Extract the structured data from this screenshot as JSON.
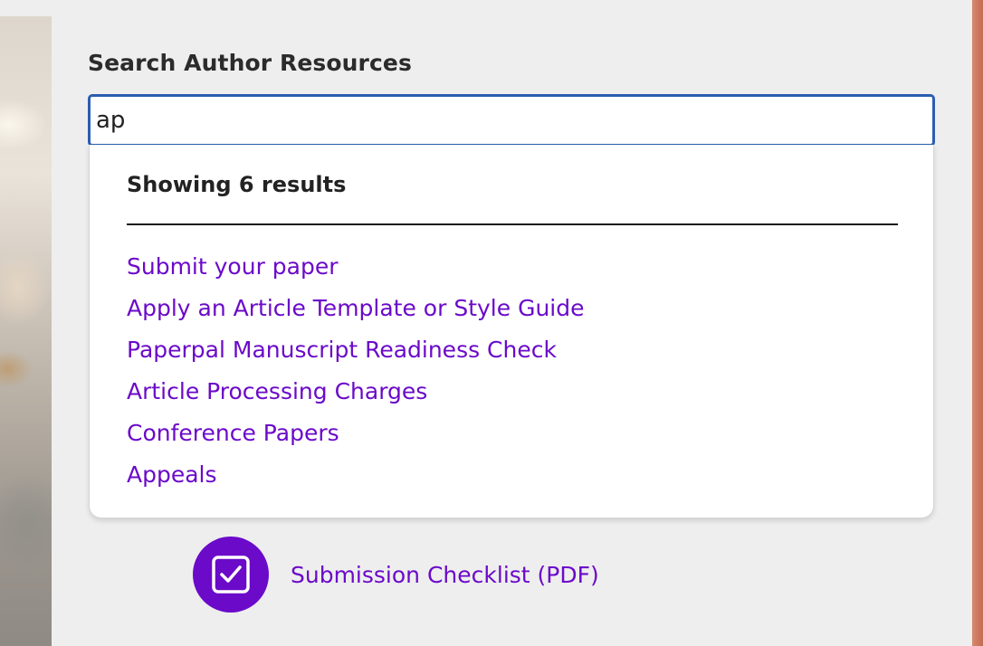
{
  "search": {
    "label": "Search Author Resources",
    "value": "ap"
  },
  "results": {
    "count_text": "Showing 6 results",
    "items": [
      {
        "label": "Submit your paper"
      },
      {
        "label": "Apply an Article Template or Style Guide"
      },
      {
        "label": "Paperpal Manuscript Readiness Check"
      },
      {
        "label": "Article Processing Charges"
      },
      {
        "label": "Conference Papers"
      },
      {
        "label": "Appeals"
      }
    ]
  },
  "checklist": {
    "label": "Submission Checklist (PDF)",
    "icon": "checkbox-checked-icon"
  },
  "colors": {
    "link": "#6b0ac9",
    "input_border": "#2a5db0",
    "background": "#eeeeee"
  }
}
